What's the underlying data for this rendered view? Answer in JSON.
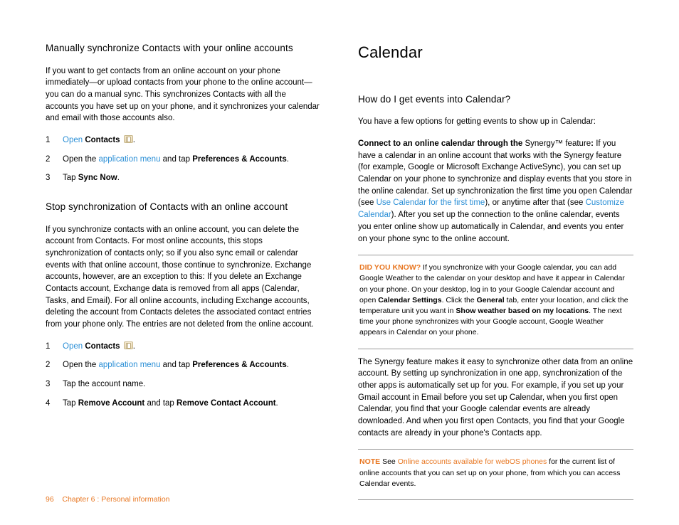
{
  "left": {
    "h1": "Manually synchronize Contacts with your online accounts",
    "p1": "If you want to get contacts from an online account on your phone immediately—or upload contacts from your phone to the online account—you can do a manual sync. This synchronizes Contacts with all the accounts you have set up on your phone, and it synchronizes your calendar and email with those accounts also.",
    "s1": {
      "r1": {
        "n": "1",
        "open": "Open",
        "bold": "Contacts",
        "dot": "."
      },
      "r2": {
        "n": "2",
        "pre": "Open the ",
        "link": "application menu",
        "mid": " and tap ",
        "bold": "Preferences & Accounts",
        "dot": "."
      },
      "r3": {
        "n": "3",
        "pre": "Tap ",
        "bold": "Sync Now",
        "dot": "."
      }
    },
    "h2": "Stop synchronization of Contacts with an online account",
    "p2": "If you synchronize contacts with an online account, you can delete the account from Contacts. For most online accounts, this stops synchronization of contacts only; so if you also sync email or calendar events with that online account, those continue to synchronize. Exchange accounts, however, are an exception to this: If you delete an Exchange Contacts account, Exchange data is removed from all apps (Calendar, Tasks, and Email). For all online accounts, including Exchange accounts, deleting the account from Contacts deletes the associated contact entries from your phone only. The entries are not deleted from the online account.",
    "s2": {
      "r1": {
        "n": "1",
        "open": "Open",
        "bold": "Contacts",
        "dot": "."
      },
      "r2": {
        "n": "2",
        "pre": "Open the ",
        "link": "application menu",
        "mid": " and tap ",
        "bold": "Preferences & Accounts",
        "dot": "."
      },
      "r3": {
        "n": "3",
        "txt": "Tap the account name."
      },
      "r4": {
        "n": "4",
        "pre": "Tap ",
        "b1": "Remove Account",
        "mid": " and tap ",
        "b2": "Remove Contact Account",
        "dot": "."
      }
    }
  },
  "right": {
    "title": "Calendar",
    "h1": "How do I get events into Calendar?",
    "p1": "You have a few options for getting events to show up in Calendar:",
    "p2a": "Connect to an online calendar through the ",
    "p2b": "Synergy™ feature",
    "p2c": ": ",
    "p2d": "If you have a calendar in an online account that works with the Synergy feature (for example, Google or Microsoft Exchange ActiveSync), you can set up Calendar on your phone to synchronize and display events that you store in the online calendar. Set up synchronization the first time you open Calendar (see ",
    "p2link1": "Use Calendar for the first time",
    "p2e": "), or anytime after that (see ",
    "p2link2": "Customize Calendar",
    "p2f": "). After you set up the connection to the online calendar, events you enter online show up automatically in Calendar, and events you enter on your phone sync to the online account.",
    "c1": {
      "lead": "DID YOU KNOW?",
      "a": " If you synchronize with your Google calendar, you can add Google Weather to the calendar on your desktop and have it appear in Calendar on your phone. On your desktop, log in to your Google Calendar account and open ",
      "b1": "Calendar Settings",
      "b": ". Click the ",
      "b2": "General",
      "c": " tab, enter your location, and click the temperature unit you want in ",
      "b3": "Show weather based on my locations",
      "d": ". The next time your phone synchronizes with your Google account, Google Weather appears in Calendar on your phone."
    },
    "p3": "The Synergy feature makes it easy to synchronize other data from an online account. By setting up synchronization in one app, synchronization of the other apps is automatically set up for you. For example, if you set up your Gmail account in Email before you set up Calendar, when you first open Calendar, you find that your Google calendar events are already downloaded. And when you first open Contacts, you find that your Google contacts are already in your phone's Contacts app.",
    "c2": {
      "lead": "NOTE",
      "a": " See ",
      "link": "Online accounts available for webOS phones",
      "b": " for the current list of online accounts that you can set up on your phone, from which you can access Calendar events."
    }
  },
  "footer": {
    "page": "96",
    "sep": "Chapter 6 : Personal information"
  }
}
